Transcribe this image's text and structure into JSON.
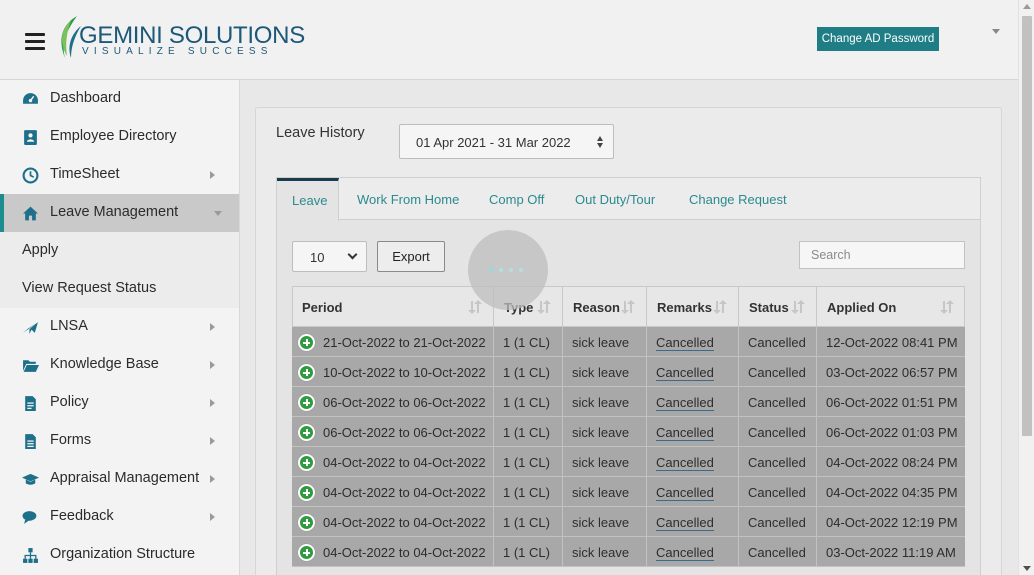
{
  "header": {
    "logo_name": "GEMINI SOLUTIONS",
    "logo_tagline": "VISUALIZE SUCCESS",
    "change_ad_password": "Change AD Password"
  },
  "sidebar": {
    "items": [
      {
        "label": "Dashboard",
        "icon": "dashboard-icon",
        "arrow": false
      },
      {
        "label": "Employee Directory",
        "icon": "address-book-icon",
        "arrow": false
      },
      {
        "label": "TimeSheet",
        "icon": "clock-icon",
        "arrow": true
      },
      {
        "label": "Leave Management",
        "icon": "home-icon",
        "arrow": true,
        "active": true
      },
      {
        "label": "LNSA",
        "icon": "plane-icon",
        "arrow": true
      },
      {
        "label": "Knowledge Base",
        "icon": "folder-open-icon",
        "arrow": true
      },
      {
        "label": "Policy",
        "icon": "document-icon",
        "arrow": true
      },
      {
        "label": "Forms",
        "icon": "form-icon",
        "arrow": true
      },
      {
        "label": "Appraisal Management",
        "icon": "graduation-cap-icon",
        "arrow": true
      },
      {
        "label": "Feedback",
        "icon": "comments-icon",
        "arrow": true
      },
      {
        "label": "Organization Structure",
        "icon": "sitemap-icon",
        "arrow": false
      }
    ],
    "sub_items": [
      "Apply",
      "View Request Status"
    ]
  },
  "main": {
    "leave_history_label": "Leave History",
    "financial_year": "01 Apr 2021 - 31 Mar 2022",
    "tabs": [
      "Leave",
      "Work From Home",
      "Comp Off",
      "Out Duty/Tour",
      "Change Request"
    ],
    "active_tab": "Leave",
    "page_length": "10",
    "export_label": "Export",
    "search_placeholder": "Search"
  },
  "table": {
    "columns": [
      "Period",
      "Type",
      "Reason",
      "Remarks",
      "Status",
      "Applied On"
    ],
    "rows": [
      [
        "21-Oct-2022 to 21-Oct-2022",
        "1 (1 CL)",
        "sick leave",
        "Cancelled",
        "Cancelled",
        "12-Oct-2022 08:41 PM"
      ],
      [
        "10-Oct-2022 to 10-Oct-2022",
        "1 (1 CL)",
        "sick leave",
        "Cancelled",
        "Cancelled",
        "03-Oct-2022 06:57 PM"
      ],
      [
        "06-Oct-2022 to 06-Oct-2022",
        "1 (1 CL)",
        "sick leave",
        "Cancelled",
        "Cancelled",
        "06-Oct-2022 01:51 PM"
      ],
      [
        "06-Oct-2022 to 06-Oct-2022",
        "1 (1 CL)",
        "sick leave",
        "Cancelled",
        "Cancelled",
        "06-Oct-2022 01:03 PM"
      ],
      [
        "04-Oct-2022 to 04-Oct-2022",
        "1 (1 CL)",
        "sick leave",
        "Cancelled",
        "Cancelled",
        "04-Oct-2022 08:24 PM"
      ],
      [
        "04-Oct-2022 to 04-Oct-2022",
        "1 (1 CL)",
        "sick leave",
        "Cancelled",
        "Cancelled",
        "04-Oct-2022 04:35 PM"
      ],
      [
        "04-Oct-2022 to 04-Oct-2022",
        "1 (1 CL)",
        "sick leave",
        "Cancelled",
        "Cancelled",
        "04-Oct-2022 12:19 PM"
      ],
      [
        "04-Oct-2022 to 04-Oct-2022",
        "1 (1 CL)",
        "sick leave",
        "Cancelled",
        "Cancelled",
        "03-Oct-2022 11:19 AM"
      ]
    ]
  },
  "colors": {
    "accent": "#1f7d86",
    "row_bg": "#a8a8a8",
    "expand_button": "#2e9b3f",
    "tab_text": "#2a8a8e"
  }
}
